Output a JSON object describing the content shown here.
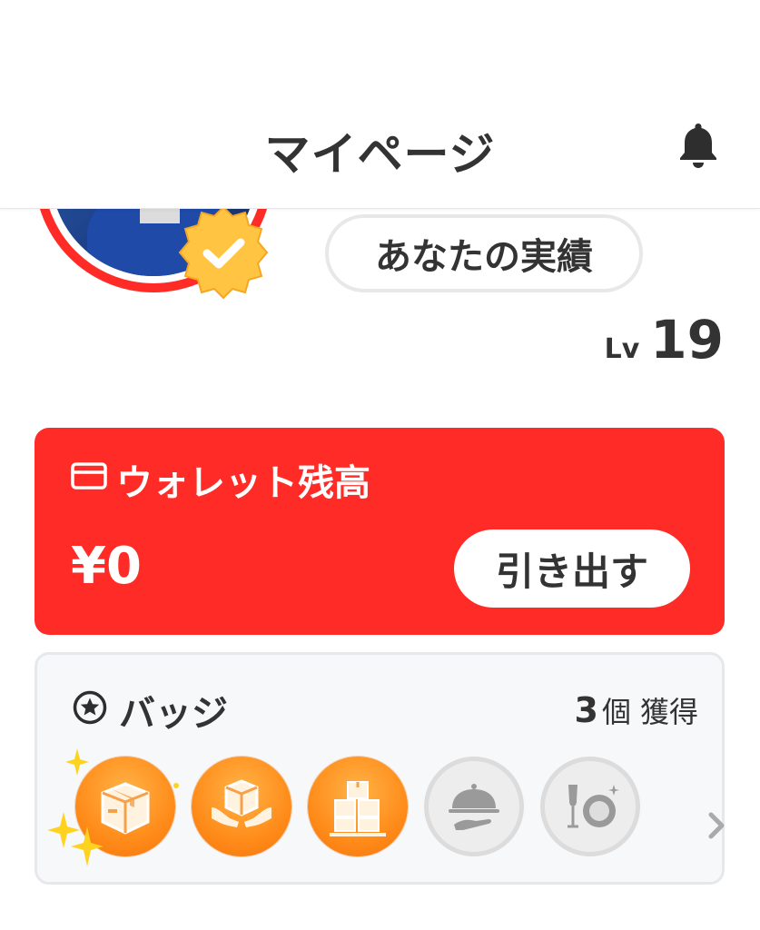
{
  "header": {
    "title": "マイページ",
    "bell_icon": "bell-icon"
  },
  "profile": {
    "achievements_label": "あなたの実績",
    "level_prefix": "Lv",
    "level_value": "19",
    "verified_icon": "verified-check-icon"
  },
  "wallet": {
    "icon": "card-icon",
    "title": "ウォレット残高",
    "amount": "¥0",
    "withdraw_label": "引き出す",
    "background_color": "#ff2b26"
  },
  "badges": {
    "icon": "star-circle-icon",
    "title": "バッジ",
    "count": "3",
    "count_unit": "個",
    "count_suffix": "獲得",
    "items": [
      {
        "icon": "box-icon",
        "earned": true
      },
      {
        "icon": "box-hands-icon",
        "earned": true
      },
      {
        "icon": "stacked-boxes-icon",
        "earned": true
      },
      {
        "icon": "serving-cloche-icon",
        "earned": false
      },
      {
        "icon": "dining-glass-plate-icon",
        "earned": false
      }
    ],
    "more_icon": "chevron-right-icon",
    "earned_color": "#ff8c1a",
    "locked_color": "#dcdcdc"
  }
}
